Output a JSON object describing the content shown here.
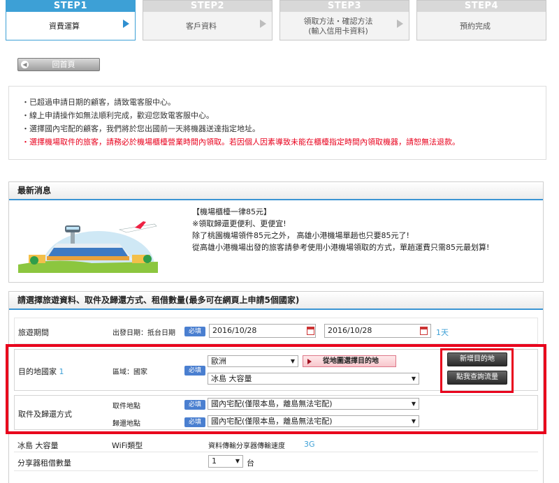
{
  "steps": [
    {
      "num": "STEP1",
      "label": "資費運算"
    },
    {
      "num": "STEP2",
      "label": "客戶資料"
    },
    {
      "num": "STEP3",
      "label": "領取方法・確認方法\n(輸入信用卡資料)"
    },
    {
      "num": "STEP4",
      "label": "預約完成"
    }
  ],
  "home_button": "回首頁",
  "notices": [
    "・已超過申請日期的顧客，請致電客服中心。",
    "・線上申請操作如無法順利完成，歡迎您致電客服中心。",
    "・選擇國內宅配的顧客，我們將於您出國前一天將機器送達指定地址。",
    "・選擇機場取件的旅客，請務必於機場櫃檯營業時間內領取。若因個人因素導致未能在櫃檯指定時間內領取機器，請恕無法退款。"
  ],
  "news": {
    "heading": "最新消息",
    "lines": [
      "【機場櫃檯一律85元】",
      "※領取歸還更便利、更便宜!",
      "除了桃園機場領件85元之外， 高雄小港機場單趟也只要85元了!",
      "從高雄小港機場出發的旅客請參考使用小港機場領取的方式，單趟運費只需85元最划算!"
    ]
  },
  "form": {
    "heading": "請選擇旅遊資料、取件及歸還方式、租借數量(最多可在網頁上申請5個國家)",
    "required": "必填",
    "period": {
      "label": "旅遊期間",
      "date_label": "出發日期：抵台日期",
      "start": "2016/10/28",
      "end": "2016/10/28",
      "days": "1天"
    },
    "destination": {
      "label": "目的地國家",
      "index": "1",
      "region_label": "區域：國家",
      "region": "歐洲",
      "country": "冰島 大容量",
      "map_button": "從地圖選擇目的地",
      "add_button": "新增目的地",
      "traffic_button": "點我查詢流量"
    },
    "pickup": {
      "label": "取件及歸還方式",
      "pickup_label": "取件地點",
      "return_label": "歸還地點",
      "pickup_value": "國內宅配(僅限本島，離島無法宅配)",
      "return_value": "國內宅配(僅限本島，離島無法宅配)"
    },
    "device": {
      "country": "冰島 大容量",
      "wifi_label": "WiFi類型",
      "device_type": "資料傳輸分享器",
      "speed_label": "傳輸速度",
      "speed": "3G"
    },
    "quantity": {
      "label": "分享器租借數量",
      "value": "1",
      "unit": "台"
    }
  },
  "colors": {
    "accent": "#3da0d6",
    "highlight": "#e8001c",
    "required": "#4a7fd0"
  }
}
